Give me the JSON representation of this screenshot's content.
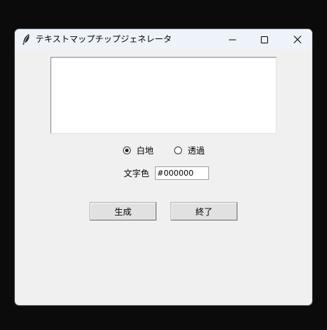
{
  "window": {
    "title": "テキストマップチップジェネレータ",
    "icon": "feather-icon"
  },
  "controls": {
    "minimize": "minimize-icon",
    "maximize": "maximize-icon",
    "close": "close-icon"
  },
  "text_input": {
    "value": ""
  },
  "background_options": [
    {
      "label": "白地",
      "selected": true
    },
    {
      "label": "透過",
      "selected": false
    }
  ],
  "text_color": {
    "label": "文字色",
    "value": "#000000"
  },
  "buttons": {
    "generate": "生成",
    "quit": "終了"
  }
}
